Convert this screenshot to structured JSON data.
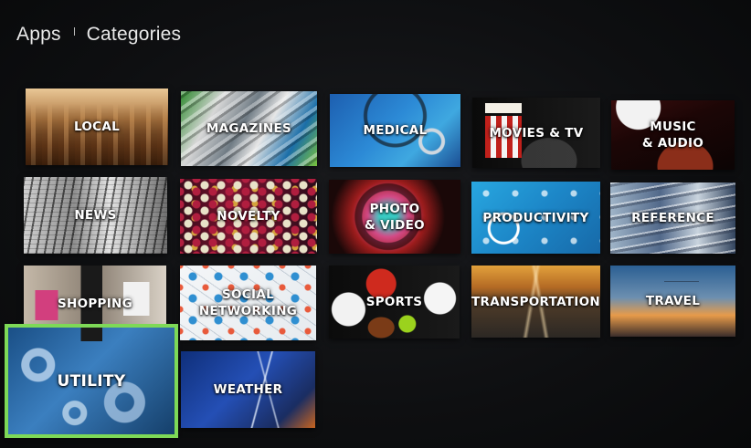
{
  "header": {
    "section": "Apps",
    "page_title": "Categories"
  },
  "categories": [
    {
      "key": "local",
      "label": "LOCAL"
    },
    {
      "key": "magazines",
      "label": "MAGAZINES"
    },
    {
      "key": "medical",
      "label": "MEDICAL"
    },
    {
      "key": "movies_tv",
      "label": "MOVIES & TV"
    },
    {
      "key": "music_audio",
      "label": "MUSIC\n& AUDIO"
    },
    {
      "key": "news",
      "label": "NEWS"
    },
    {
      "key": "novelty",
      "label": "NOVELTY"
    },
    {
      "key": "photo_video",
      "label": "PHOTO\n& VIDEO"
    },
    {
      "key": "productivity",
      "label": "PRODUCTIVITY"
    },
    {
      "key": "reference",
      "label": "REFERENCE"
    },
    {
      "key": "shopping",
      "label": "SHOPPING"
    },
    {
      "key": "social_networking",
      "label": "SOCIAL\nNETWORKING"
    },
    {
      "key": "sports",
      "label": "SPORTS"
    },
    {
      "key": "transportation",
      "label": "TRANSPORTATION"
    },
    {
      "key": "travel",
      "label": "TRAVEL"
    },
    {
      "key": "utility",
      "label": "UTILITY"
    },
    {
      "key": "weather",
      "label": "WEATHER"
    }
  ],
  "focused_category": "UTILITY",
  "colors": {
    "focus_ring": "#7ed957",
    "background": "#0e0f11"
  }
}
